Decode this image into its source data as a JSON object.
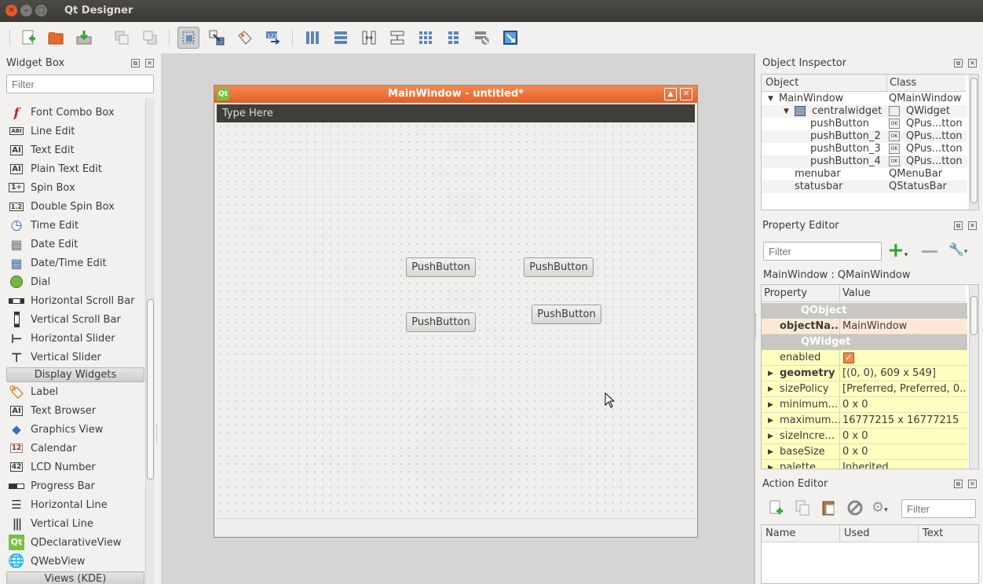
{
  "window": {
    "title": "Qt Designer"
  },
  "colors": {
    "accent_orange": "#e8682f",
    "titlebar": "#3c3b37",
    "prop_yellow": "#ffffc0",
    "prop_peach": "#ffe9d6"
  },
  "toolbar": {
    "icons": [
      "new-form-icon",
      "open-form-icon",
      "save-form-icon",
      "send-to-back-icon",
      "bring-to-front-icon",
      "edit-widgets-icon",
      "edit-signals-slots-icon",
      "edit-buddies-icon",
      "edit-tab-order-icon",
      "layout-horizontal-icon",
      "layout-vertical-icon",
      "layout-h-splitter-icon",
      "layout-v-splitter-icon",
      "layout-grid-icon",
      "layout-form-icon",
      "break-layout-icon",
      "adjust-size-icon"
    ]
  },
  "widget_box": {
    "title": "Widget Box",
    "filter_placeholder": "Filter",
    "items": [
      {
        "label": "Font Combo Box",
        "icon": "font-combo-icon"
      },
      {
        "label": "Line Edit",
        "icon": "line-edit-icon"
      },
      {
        "label": "Text Edit",
        "icon": "text-edit-icon"
      },
      {
        "label": "Plain Text Edit",
        "icon": "plain-text-edit-icon"
      },
      {
        "label": "Spin Box",
        "icon": "spin-box-icon"
      },
      {
        "label": "Double Spin Box",
        "icon": "double-spin-box-icon"
      },
      {
        "label": "Time Edit",
        "icon": "clock-icon"
      },
      {
        "label": "Date Edit",
        "icon": "calendar-grid-icon"
      },
      {
        "label": "Date/Time Edit",
        "icon": "date-time-icon"
      },
      {
        "label": "Dial",
        "icon": "dial-icon"
      },
      {
        "label": "Horizontal Scroll Bar",
        "icon": "h-scrollbar-icon"
      },
      {
        "label": "Vertical Scroll Bar",
        "icon": "v-scrollbar-icon"
      },
      {
        "label": "Horizontal Slider",
        "icon": "h-slider-icon"
      },
      {
        "label": "Vertical Slider",
        "icon": "v-slider-icon"
      }
    ],
    "category_display": "Display Widgets",
    "display_items": [
      {
        "label": "Label",
        "icon": "label-tag-icon"
      },
      {
        "label": "Text Browser",
        "icon": "text-browser-icon"
      },
      {
        "label": "Graphics View",
        "icon": "graphics-view-icon"
      },
      {
        "label": "Calendar",
        "icon": "calendar-icon"
      },
      {
        "label": "LCD Number",
        "icon": "lcd-number-icon"
      },
      {
        "label": "Progress Bar",
        "icon": "progress-bar-icon"
      },
      {
        "label": "Horizontal Line",
        "icon": "h-line-icon"
      },
      {
        "label": "Vertical Line",
        "icon": "v-line-icon"
      },
      {
        "label": "QDeclarativeView",
        "icon": "qt-logo-icon"
      },
      {
        "label": "QWebView",
        "icon": "globe-icon"
      }
    ],
    "category_views": "Views (KDE)"
  },
  "form": {
    "title": "MainWindow - untitled*",
    "menubar_text": "Type Here",
    "buttons": [
      "PushButton",
      "PushButton",
      "PushButton",
      "PushButton"
    ]
  },
  "object_inspector": {
    "title": "Object Inspector",
    "col_object": "Object",
    "col_class": "Class",
    "rows": [
      {
        "object": "MainWindow",
        "class": "QMainWindow"
      },
      {
        "object": "centralwidget",
        "class": "QWidget"
      },
      {
        "object": "pushButton",
        "class": "QPus...tton"
      },
      {
        "object": "pushButton_2",
        "class": "QPus...tton"
      },
      {
        "object": "pushButton_3",
        "class": "QPus...tton"
      },
      {
        "object": "pushButton_4",
        "class": "QPus...tton"
      },
      {
        "object": "menubar",
        "class": "QMenuBar"
      },
      {
        "object": "statusbar",
        "class": "QStatusBar"
      }
    ]
  },
  "property_editor": {
    "title": "Property Editor",
    "filter_placeholder": "Filter",
    "context": "MainWindow : QMainWindow",
    "col_property": "Property",
    "col_value": "Value",
    "rows": [
      {
        "name": "QObject",
        "value": ""
      },
      {
        "name": "objectNa...",
        "value": "MainWindow"
      },
      {
        "name": "QWidget",
        "value": ""
      },
      {
        "name": "enabled",
        "value": ""
      },
      {
        "name": "geometry",
        "value": "[(0, 0), 609 x 549]"
      },
      {
        "name": "sizePolicy",
        "value": "[Preferred, Preferred, 0..."
      },
      {
        "name": "minimum...",
        "value": "0 x 0"
      },
      {
        "name": "maximum...",
        "value": "16777215 x 16777215"
      },
      {
        "name": "sizeIncre...",
        "value": "0 x 0"
      },
      {
        "name": "baseSize",
        "value": "0 x 0"
      },
      {
        "name": "palette",
        "value": "Inherited"
      }
    ],
    "enabled_checked": true
  },
  "action_editor": {
    "title": "Action Editor",
    "filter_placeholder": "Filter",
    "col_name": "Name",
    "col_used": "Used",
    "col_text": "Text"
  }
}
